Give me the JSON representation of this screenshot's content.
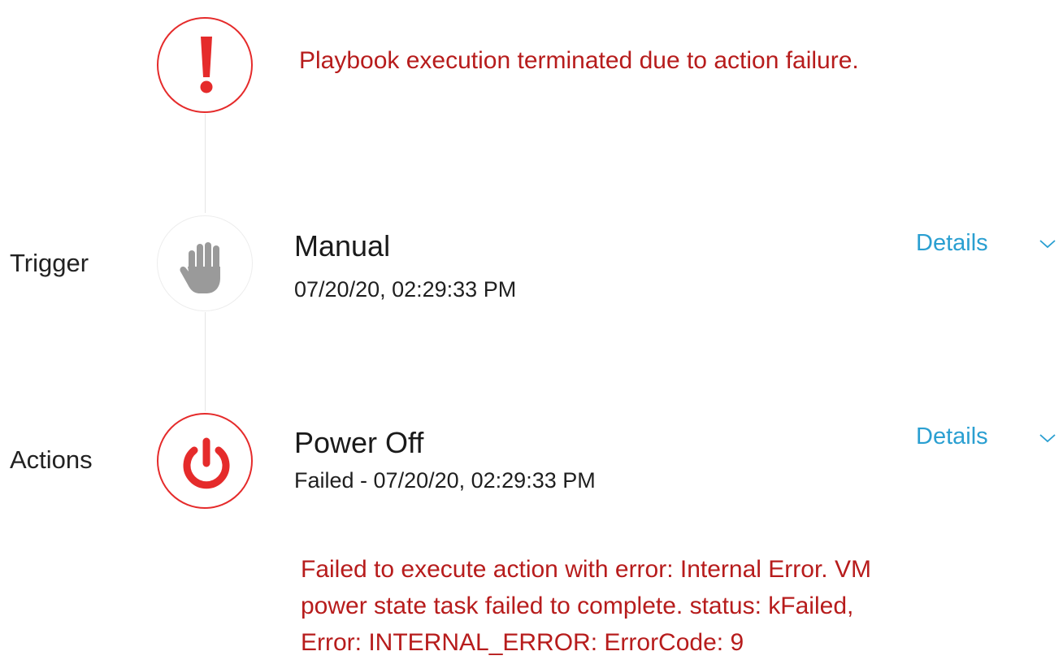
{
  "status_banner": {
    "icon": "exclamation-icon",
    "message": "Playbook execution terminated due to action failure.",
    "color": "#b71c1c"
  },
  "trigger": {
    "section_label": "Trigger",
    "icon": "hand-icon",
    "title": "Manual",
    "timestamp": "07/20/20, 02:29:33 PM",
    "details_label": "Details"
  },
  "actions": {
    "section_label": "Actions",
    "icon": "power-icon",
    "title": "Power Off",
    "status_line": "Failed - 07/20/20, 02:29:33 PM",
    "details_label": "Details",
    "error_lines": [
      "Failed to execute action with error: Internal Error. VM",
      "power state task failed to complete. status: kFailed,",
      "Error: INTERNAL_ERROR: ErrorCode: 9"
    ]
  },
  "colors": {
    "error_red": "#e52b2b",
    "error_text": "#b71c1c",
    "link_blue": "#2a9fd1",
    "hand_gray": "#9a9a9a"
  }
}
